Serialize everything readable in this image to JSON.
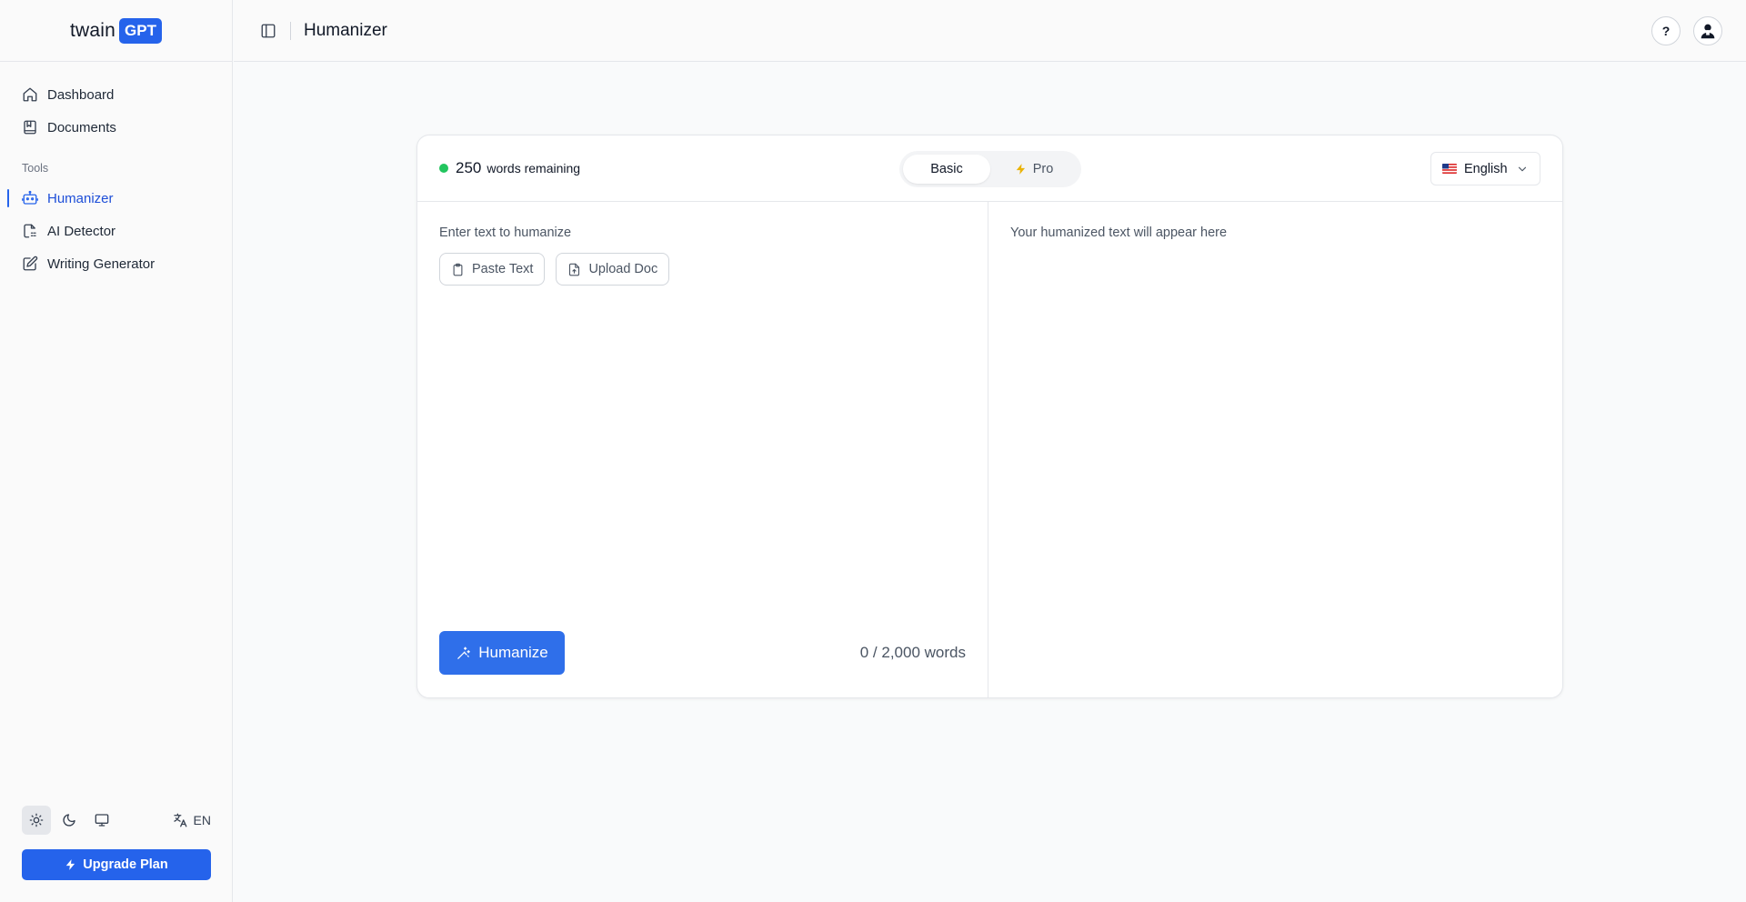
{
  "brand": {
    "word": "twain",
    "badge": "GPT"
  },
  "sidebar": {
    "nav": [
      {
        "label": "Dashboard"
      },
      {
        "label": "Documents"
      }
    ],
    "tools_heading": "Tools",
    "tools": [
      {
        "label": "Humanizer",
        "active": true
      },
      {
        "label": "AI Detector"
      },
      {
        "label": "Writing Generator"
      }
    ],
    "language_code": "EN",
    "upgrade_label": "Upgrade Plan"
  },
  "header": {
    "title": "Humanizer",
    "help_label": "?"
  },
  "card": {
    "words_remaining_count": "250",
    "words_remaining_text": "words remaining",
    "modes": [
      {
        "label": "Basic",
        "selected": true
      },
      {
        "label": "Pro",
        "selected": false
      }
    ],
    "language": "English",
    "input_label": "Enter text to humanize",
    "input_value": "",
    "paste_label": "Paste Text",
    "upload_label": "Upload Doc",
    "humanize_label": "Humanize",
    "word_count": "0 / 2,000 words",
    "output_placeholder": "Your humanized text will appear here"
  },
  "colors": {
    "accent": "#2563eb",
    "status_dot": "#22c55e",
    "pro_bolt": "#eab308"
  }
}
